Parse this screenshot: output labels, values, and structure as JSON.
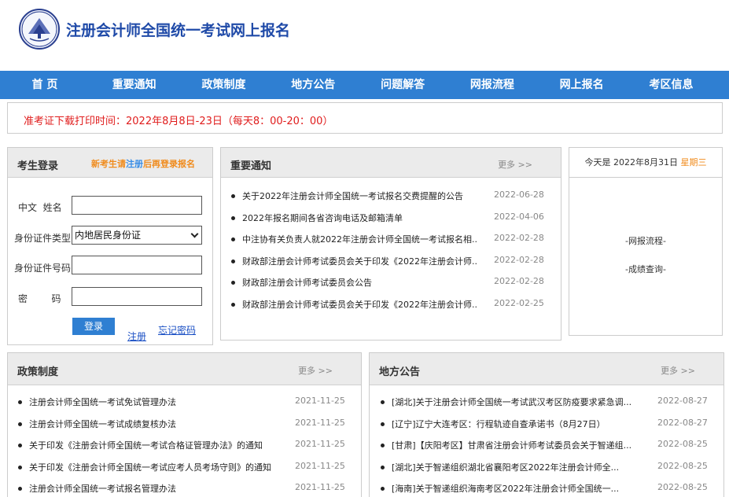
{
  "site": {
    "title": "注册会计师全国统一考试网上报名"
  },
  "nav": [
    "首 页",
    "重要通知",
    "政策制度",
    "地方公告",
    "问题解答",
    "网报流程",
    "网上报名",
    "考区信息"
  ],
  "notice": "准考证下载打印时间：2022年8月8日-23日（每天8：00-20：00）",
  "login": {
    "title": "考生登录",
    "hint_prefix": "新考生请",
    "hint_link": "注册",
    "hint_suffix": "后再登录报名",
    "name_label": "中文  姓名",
    "id_type_label": "身份证件类型",
    "id_type_value": "内地居民身份证",
    "id_no_label": "身份证件号码",
    "password_label": "密        码",
    "name_value": "",
    "id_no_value": "",
    "password_value": "",
    "login_button": "登录",
    "register_link": "注册",
    "forgot_link": "忘记密码"
  },
  "important": {
    "title": "重要通知",
    "more": "更多 >>",
    "items": [
      {
        "title": "关于2022年注册会计师全国统一考试报名交费提醒的公告",
        "date": "2022-06-28"
      },
      {
        "title": "2022年报名期间各省咨询电话及邮箱清单",
        "date": "2022-04-06"
      },
      {
        "title": "中注协有关负责人就2022年注册会计师全国统一考试报名相...",
        "date": "2022-02-28"
      },
      {
        "title": "财政部注册会计师考试委员会关于印发《2022年注册会计师...",
        "date": "2022-02-28"
      },
      {
        "title": "财政部注册会计师考试委员会公告",
        "date": "2022-02-28"
      },
      {
        "title": "财政部注册会计师考试委员会关于印发《2022年注册会计师...",
        "date": "2022-02-25"
      }
    ]
  },
  "today": {
    "prefix": "今天是 2022年8月31日",
    "weekday": "星期三",
    "link1": "-网报流程-",
    "link2": "-成绩查询-"
  },
  "policy": {
    "title": "政策制度",
    "more": "更多 >>",
    "items": [
      {
        "title": "注册会计师全国统一考试免试管理办法",
        "date": "2021-11-25"
      },
      {
        "title": "注册会计师全国统一考试成绩复核办法",
        "date": "2021-11-25"
      },
      {
        "title": "关于印发《注册会计师全国统一考试合格证管理办法》的通知",
        "date": "2021-11-25"
      },
      {
        "title": "关于印发《注册会计师全国统一考试应考人员考场守则》的通知",
        "date": "2021-11-25"
      },
      {
        "title": "注册会计师全国统一考试报名管理办法",
        "date": "2021-11-25"
      }
    ]
  },
  "local": {
    "title": "地方公告",
    "more": "更多 >>",
    "items": [
      {
        "title": "[湖北]关于注册会计师全国统一考试武汉考区防疫要求紧急调...",
        "date": "2022-08-27"
      },
      {
        "title": "[辽宁]辽宁大连考区：行程轨迹自查承诺书（8月27日）",
        "date": "2022-08-27"
      },
      {
        "title": "[甘肃]【庆阳考区】甘肃省注册会计师考试委员会关于智递组...",
        "date": "2022-08-25"
      },
      {
        "title": "[湖北]关于智递组织湖北省襄阳考区2022年注册会计师全...",
        "date": "2022-08-25"
      },
      {
        "title": "[海南]关于智递组织海南考区2022年注册会计师全国统一...",
        "date": "2022-08-25"
      }
    ]
  }
}
